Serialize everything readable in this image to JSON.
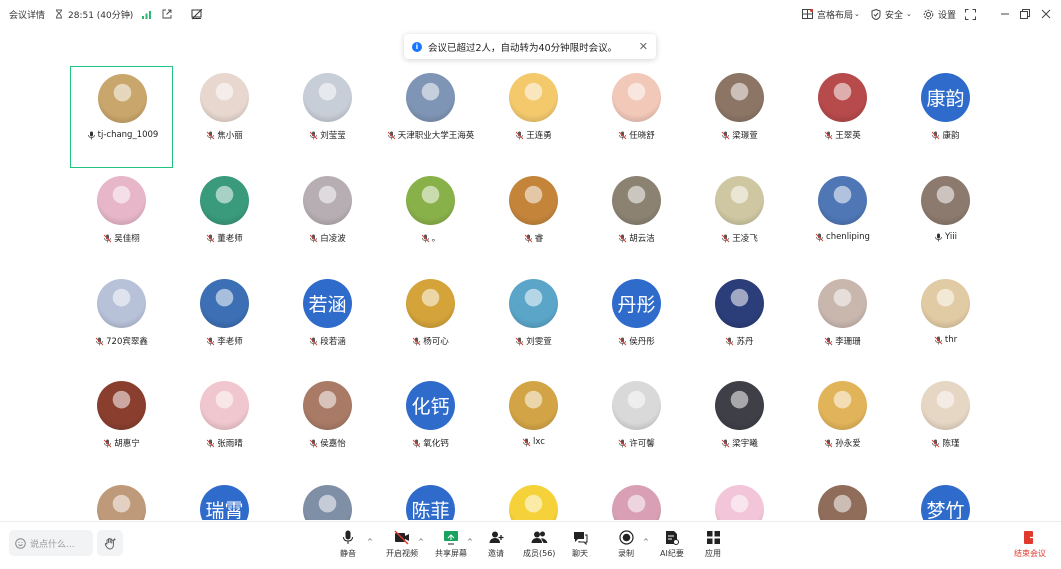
{
  "topbar": {
    "meeting_details": "会议详情",
    "timer": "28:51 (40分钟)",
    "layout_label": "宫格布局",
    "security_label": "安全",
    "settings_label": "设置"
  },
  "toast": {
    "message": "会议已超过2人，自动转为40分钟限时会议。"
  },
  "participants": [
    {
      "name": "tj-chang_1009",
      "text": "",
      "color": "#c9a66b",
      "muted": false,
      "active": true
    },
    {
      "name": "焦小丽",
      "text": "",
      "color": "#e7d7cf",
      "muted": true
    },
    {
      "name": "刘莹莹",
      "text": "",
      "color": "#c8ced7",
      "muted": true
    },
    {
      "name": "天津职业大学王海英",
      "text": "",
      "color": "#7f95b5",
      "muted": true
    },
    {
      "name": "王连勇",
      "text": "",
      "color": "#f3c96c",
      "muted": true
    },
    {
      "name": "任晓舒",
      "text": "",
      "color": "#f2c8b9",
      "muted": true
    },
    {
      "name": "梁璟萱",
      "text": "",
      "color": "#8d7566",
      "muted": true
    },
    {
      "name": "王翠英",
      "text": "",
      "color": "#b74a4a",
      "muted": true
    },
    {
      "name": "康韵",
      "text": "康韵",
      "color": "#2f6bcb",
      "muted": true
    },
    {
      "name": "吴佳栩",
      "text": "",
      "color": "#e7b6c9",
      "muted": true
    },
    {
      "name": "董老师",
      "text": "",
      "color": "#3a9a7c",
      "muted": true
    },
    {
      "name": "白凌波",
      "text": "",
      "color": "#b6aeb3",
      "muted": true
    },
    {
      "name": "。",
      "text": "",
      "color": "#89b14a",
      "muted": true
    },
    {
      "name": "睿",
      "text": "",
      "color": "#c4853b",
      "muted": true
    },
    {
      "name": "胡云洁",
      "text": "",
      "color": "#8b8272",
      "muted": true
    },
    {
      "name": "王凌飞",
      "text": "",
      "color": "#cfc7a1",
      "muted": true
    },
    {
      "name": "chenliping",
      "text": "",
      "color": "#4f77b6",
      "muted": true
    },
    {
      "name": "Yiii",
      "text": "",
      "color": "#8d7a6e",
      "muted": false
    },
    {
      "name": "720宾翠鑫",
      "text": "",
      "color": "#b7c2d9",
      "muted": true
    },
    {
      "name": "李老师",
      "text": "",
      "color": "#3c6fb4",
      "muted": true
    },
    {
      "name": "段若涵",
      "text": "若涵",
      "color": "#2f6bcb",
      "muted": true
    },
    {
      "name": "杨可心",
      "text": "",
      "color": "#d4a33a",
      "muted": true
    },
    {
      "name": "刘雯萱",
      "text": "",
      "color": "#5aa5c8",
      "muted": true
    },
    {
      "name": "侯丹彤",
      "text": "丹彤",
      "color": "#2f6bcb",
      "muted": true
    },
    {
      "name": "苏丹",
      "text": "",
      "color": "#2c3e7a",
      "muted": true
    },
    {
      "name": "李珊珊",
      "text": "",
      "color": "#c9b7ae",
      "muted": true
    },
    {
      "name": "thr",
      "text": "",
      "color": "#e1cba4",
      "muted": true
    },
    {
      "name": "胡惠宁",
      "text": "",
      "color": "#8a3f2e",
      "muted": true
    },
    {
      "name": "张雨晴",
      "text": "",
      "color": "#f1c7cf",
      "muted": true
    },
    {
      "name": "侯嘉怡",
      "text": "",
      "color": "#a97b66",
      "muted": true
    },
    {
      "name": "氧化钙",
      "text": "化钙",
      "color": "#2f6bcb",
      "muted": true
    },
    {
      "name": "lxc",
      "text": "",
      "color": "#d3a445",
      "muted": true
    },
    {
      "name": "许可馨",
      "text": "",
      "color": "#d9d9d9",
      "muted": true
    },
    {
      "name": "梁宇曦",
      "text": "",
      "color": "#3f3f48",
      "muted": true
    },
    {
      "name": "孙永爱",
      "text": "",
      "color": "#e2b45a",
      "muted": true
    },
    {
      "name": "陈瑾",
      "text": "",
      "color": "#e6d6c4",
      "muted": true
    },
    {
      "name": "",
      "text": "",
      "color": "#bf9a7a",
      "muted": true
    },
    {
      "name": "",
      "text": "瑞霄",
      "color": "#2f6bcb",
      "muted": true
    },
    {
      "name": "",
      "text": "",
      "color": "#7f8fa6",
      "muted": true
    },
    {
      "name": "",
      "text": "陈菲",
      "color": "#2f6bcb",
      "muted": true
    },
    {
      "name": "",
      "text": "",
      "color": "#f5d23a",
      "muted": true
    },
    {
      "name": "",
      "text": "",
      "color": "#d9a0b5",
      "muted": true
    },
    {
      "name": "",
      "text": "",
      "color": "#f2c6d8",
      "muted": true
    },
    {
      "name": "",
      "text": "",
      "color": "#8f6d5a",
      "muted": true
    },
    {
      "name": "",
      "text": "梦竹",
      "color": "#2f6bcb",
      "muted": true
    }
  ],
  "bottombar": {
    "say_placeholder": "说点什么...",
    "mute": "静音",
    "video": "开启视频",
    "share": "共享屏幕",
    "invite": "邀请",
    "members": "成员(56)",
    "chat": "聊天",
    "record": "录制",
    "ai": "AI纪要",
    "apps": "应用",
    "end": "结束会议"
  }
}
